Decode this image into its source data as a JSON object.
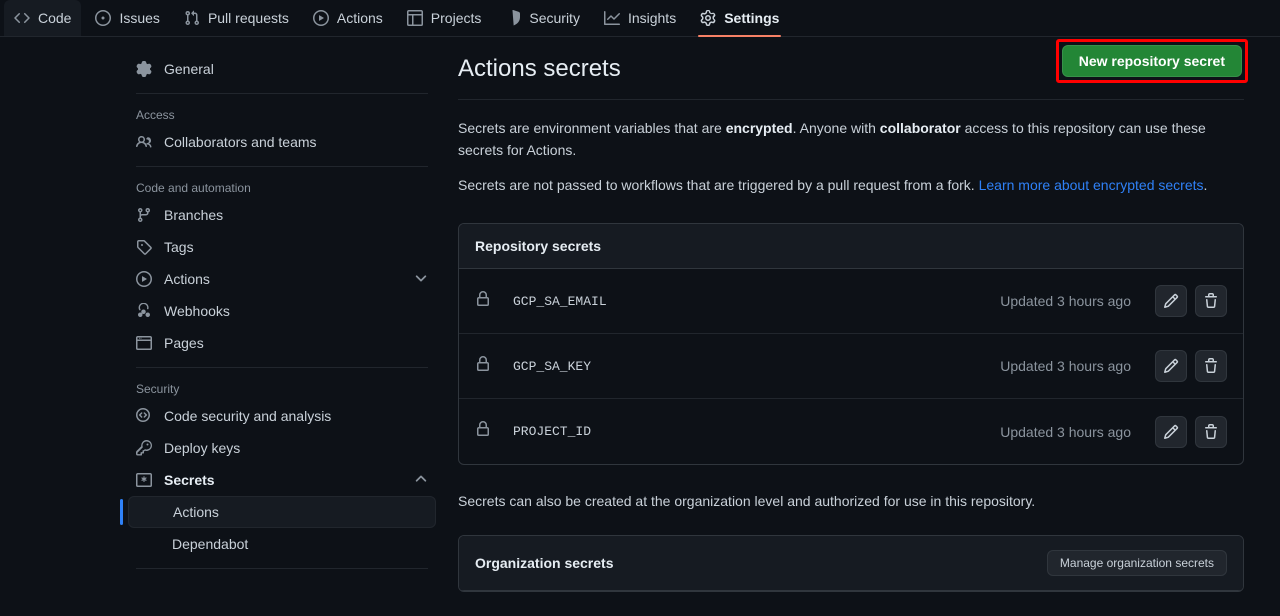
{
  "repo_nav": {
    "tabs": [
      {
        "label": "Code",
        "icon": "code-icon",
        "state": "hovered"
      },
      {
        "label": "Issues",
        "icon": "issue-opened-icon",
        "state": "normal"
      },
      {
        "label": "Pull requests",
        "icon": "git-pull-request-icon",
        "state": "normal"
      },
      {
        "label": "Actions",
        "icon": "play-icon",
        "state": "normal"
      },
      {
        "label": "Projects",
        "icon": "table-icon",
        "state": "normal"
      },
      {
        "label": "Security",
        "icon": "shield-icon",
        "state": "normal"
      },
      {
        "label": "Insights",
        "icon": "graph-icon",
        "state": "normal"
      },
      {
        "label": "Settings",
        "icon": "gear-icon",
        "state": "active"
      }
    ]
  },
  "sidebar": {
    "general": {
      "label": "General",
      "icon": "gear-icon"
    },
    "groups": [
      {
        "title": "Access",
        "items": [
          {
            "label": "Collaborators and teams",
            "icon": "people-icon"
          }
        ]
      },
      {
        "title": "Code and automation",
        "items": [
          {
            "label": "Branches",
            "icon": "git-branch-icon"
          },
          {
            "label": "Tags",
            "icon": "tag-icon"
          },
          {
            "label": "Actions",
            "icon": "play-icon",
            "expander": "chevron-down-icon"
          },
          {
            "label": "Webhooks",
            "icon": "webhook-icon"
          },
          {
            "label": "Pages",
            "icon": "browser-icon"
          }
        ]
      },
      {
        "title": "Security",
        "items": [
          {
            "label": "Code security and analysis",
            "icon": "codescan-icon"
          },
          {
            "label": "Deploy keys",
            "icon": "key-icon"
          },
          {
            "label": "Secrets",
            "icon": "secret-asterisk-icon",
            "expander": "chevron-up-icon",
            "bold": true
          }
        ]
      }
    ],
    "secrets_children": [
      {
        "label": "Actions",
        "selected": true
      },
      {
        "label": "Dependabot",
        "selected": false
      }
    ]
  },
  "main": {
    "title": "Actions secrets",
    "new_secret_button": "New repository secret",
    "annotation_color": "#ff0000",
    "description_1": {
      "part1": "Secrets are environment variables that are ",
      "bold1": "encrypted",
      "part2": ". Anyone with ",
      "bold2": "collaborator",
      "part3": " access to this repository can use these secrets for Actions."
    },
    "description_2": {
      "text": "Secrets are not passed to workflows that are triggered by a pull request from a fork. ",
      "link": "Learn more about encrypted secrets",
      "period": "."
    },
    "repository_secrets": {
      "header": "Repository secrets",
      "rows": [
        {
          "name": "GCP_SA_EMAIL",
          "updated": "Updated 3 hours ago",
          "lock": "lock-icon",
          "edit": "pencil-icon",
          "delete": "trash-icon"
        },
        {
          "name": "GCP_SA_KEY",
          "updated": "Updated 3 hours ago",
          "lock": "lock-icon",
          "edit": "pencil-icon",
          "delete": "trash-icon"
        },
        {
          "name": "PROJECT_ID",
          "updated": "Updated 3 hours ago",
          "lock": "lock-icon",
          "edit": "pencil-icon",
          "delete": "trash-icon"
        }
      ]
    },
    "org_note": "Secrets can also be created at the organization level and authorized for use in this repository.",
    "organization_secrets": {
      "header": "Organization secrets",
      "manage_button": "Manage organization secrets"
    }
  },
  "colors": {
    "background": "#0d1117",
    "panel": "#161b22",
    "border": "#30363d",
    "accent_green": "#238636",
    "accent_blue": "#2f81f7",
    "active_underline": "#f78166",
    "annotation_red": "#ff0000"
  }
}
